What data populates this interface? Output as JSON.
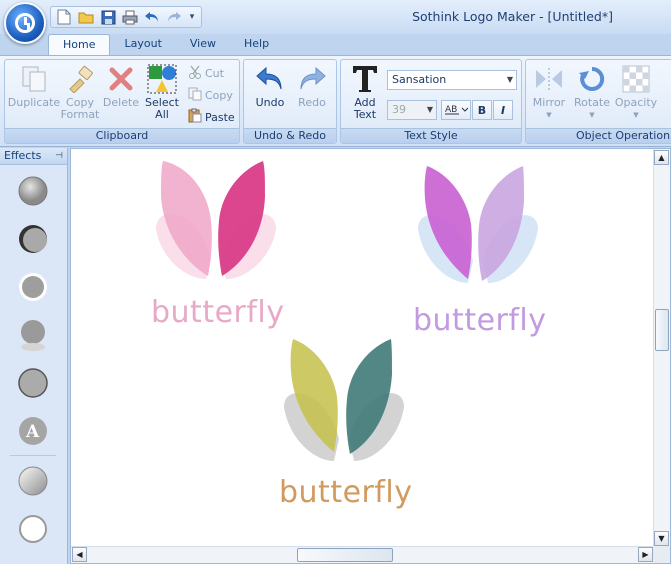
{
  "window": {
    "title": "Sothink Logo Maker - [Untitled*]"
  },
  "tabs": [
    {
      "label": "Home"
    },
    {
      "label": "Layout"
    },
    {
      "label": "View"
    },
    {
      "label": "Help"
    }
  ],
  "ribbon": {
    "clipboard": {
      "label": "Clipboard",
      "duplicate": "Duplicate",
      "copy_format_1": "Copy",
      "copy_format_2": "Format",
      "delete": "Delete",
      "select_all_1": "Select",
      "select_all_2": "All",
      "cut": "Cut",
      "copy": "Copy",
      "paste": "Paste"
    },
    "undo_redo": {
      "label": "Undo & Redo",
      "undo": "Undo",
      "redo": "Redo"
    },
    "text_style": {
      "label": "Text Style",
      "add_text_1": "Add",
      "add_text_2": "Text",
      "font": "Sansation",
      "size": "39",
      "bold": "B",
      "italic": "I"
    },
    "object_operation": {
      "label": "Object Operation",
      "mirror": "Mirror",
      "rotate": "Rotate",
      "opacity": "Opacity"
    }
  },
  "effects_panel": {
    "title": "Effects"
  },
  "logos": [
    {
      "text": "butterfly",
      "text_color": "#e8a9c8",
      "left_wing": "#f0a6c8",
      "right_wing": "#d93c88",
      "under": "#f5c3d8"
    },
    {
      "text": "butterfly",
      "text_color": "#c29ae0",
      "left_wing": "#c95fd2",
      "right_wing": "#c9a5e0",
      "under": "#bcd6f2"
    },
    {
      "text": "butterfly",
      "text_color": "#d19a5e",
      "left_wing": "#c4bf4a",
      "right_wing": "#3f7a78",
      "under": "#b5b5b5"
    }
  ]
}
